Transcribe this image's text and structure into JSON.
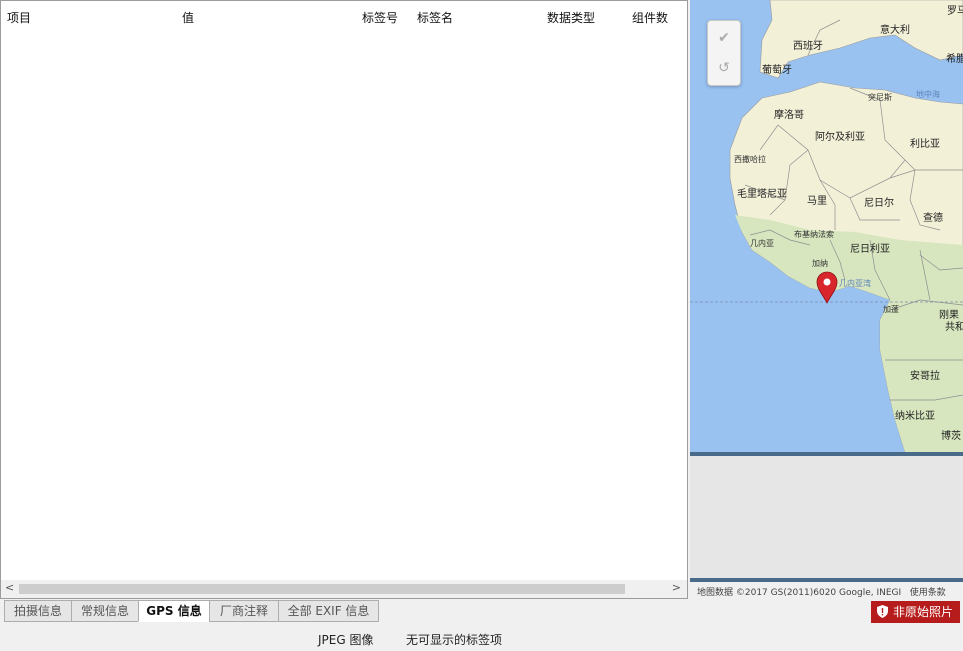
{
  "table": {
    "columns": [
      "项目",
      "值",
      "标签号",
      "标签名",
      "数据类型",
      "组件数"
    ]
  },
  "tabs": [
    "拍摄信息",
    "常规信息",
    "GPS 信息",
    "厂商注释",
    "全部 EXIF 信息"
  ],
  "active_tab": "GPS 信息",
  "status": {
    "file_type": "JPEG 图像",
    "message": "无可显示的标签项"
  },
  "map": {
    "labels": {
      "spain": "西班牙",
      "italy": "意大利",
      "portugal": "葡萄牙",
      "greece": "希腊",
      "tunisia": "突尼斯",
      "mediterranean": "地中海",
      "morocco": "摩洛哥",
      "algeria": "阿尔及利亚",
      "libya": "利比亚",
      "western_sahara": "西撒哈拉",
      "mauritania": "毛里塔尼亚",
      "mali": "马里",
      "niger": "尼日尔",
      "chad": "查德",
      "burkina": "布基纳法索",
      "guinea": "几内亚",
      "nigeria": "尼日利亚",
      "ghana": "加纳",
      "gulf_guinea": "几内亚湾",
      "gabon": "加蓬",
      "congo": "刚果",
      "republic": "共和",
      "angola": "安哥拉",
      "namibia": "纳米比亚",
      "botswana": "博茨",
      "top_right": "罗马"
    },
    "copyright": "地图数据 ©2017 GS(2011)6020 Google, INEGI",
    "terms": "使用条款",
    "controls": [
      "✔",
      "↺"
    ]
  },
  "badge": {
    "label": "非原始照片",
    "color": "#b71c1c"
  },
  "colors": {
    "water": "#99c2f1",
    "land": "#f3f0d8",
    "desert": "#ece6c4",
    "green": "#d7e6bf",
    "marker": "#d9262c"
  }
}
